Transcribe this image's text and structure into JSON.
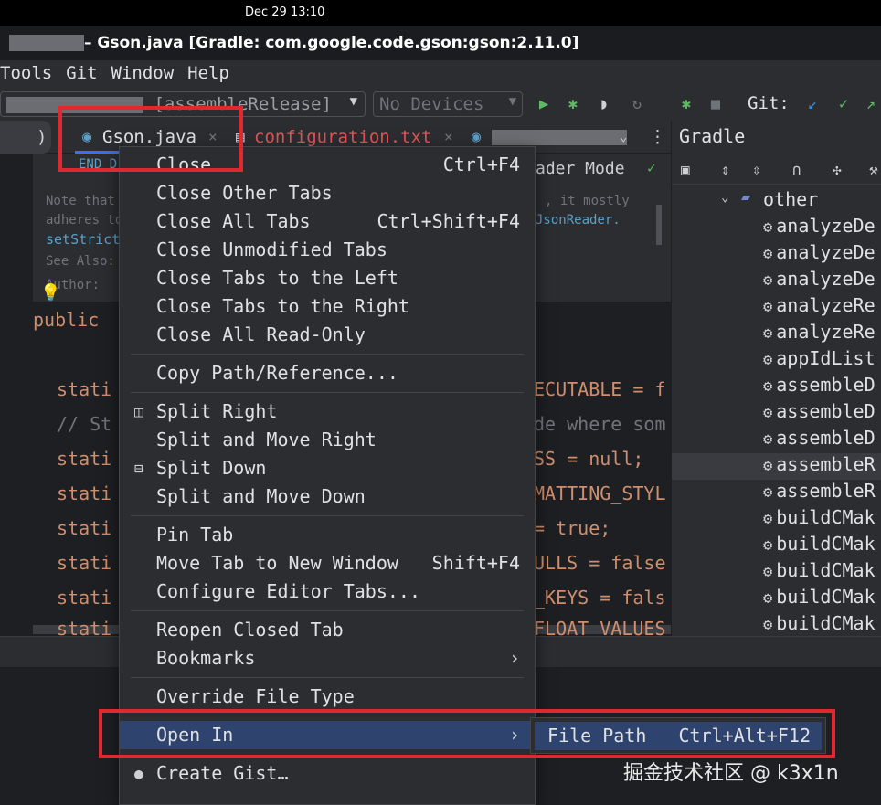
{
  "system": {
    "clock": "Dec 29  13:10"
  },
  "window": {
    "title": "– Gson.java [Gradle: com.google.code.gson:gson:2.11.0]"
  },
  "menubar": {
    "items": [
      "Tools",
      "Git",
      "Window",
      "Help"
    ]
  },
  "toolbar": {
    "config": "[assembleRelease]",
    "devices": "No Devices",
    "git_label": "Git:"
  },
  "tabs": {
    "active": "Gson.java",
    "second": "configuration.txt",
    "left_fragment": ")"
  },
  "editor": {
    "doc_lines": [
      "END D",
      "Note that",
      "adheres to",
      "setStrict",
      "See Also:",
      "Author:"
    ],
    "doc_right": [
      "ader Mode",
      ", it mostly",
      "JsonReader."
    ],
    "code_left": [
      "public",
      "stati",
      "// St",
      "stati",
      "stati",
      "stati",
      "stati",
      "stati",
      "stati"
    ],
    "code_right": [
      "ECUTABLE = f",
      "de where som",
      "SS = null;",
      "MATTING_STYL",
      " = true;",
      "ULLS = false",
      "_KEYS = fals",
      "FLOAT_VALUES"
    ]
  },
  "gradle": {
    "title": "Gradle",
    "group": "other",
    "tasks": [
      "analyzeDe",
      "analyzeDe",
      "analyzeDe",
      "analyzeRe",
      "analyzeRe",
      "appIdList",
      "assembleD",
      "assembleD",
      "assembleD",
      "assembleR",
      "assembleR",
      "buildCMak",
      "buildCMak",
      "buildCMak",
      "buildCMak",
      "buildCMak"
    ]
  },
  "context_menu": {
    "items": [
      {
        "label": "Close",
        "shortcut": "Ctrl+F4"
      },
      {
        "label": "Close Other Tabs",
        "shortcut": ""
      },
      {
        "label": "Close All Tabs",
        "shortcut": "Ctrl+Shift+F4"
      },
      {
        "label": "Close Unmodified Tabs",
        "shortcut": ""
      },
      {
        "label": "Close Tabs to the Left",
        "shortcut": ""
      },
      {
        "label": "Close Tabs to the Right",
        "shortcut": ""
      },
      {
        "label": "Close All Read-Only",
        "shortcut": ""
      },
      {
        "label": "Copy Path/Reference...",
        "shortcut": ""
      },
      {
        "label": "Split Right",
        "shortcut": ""
      },
      {
        "label": "Split and Move Right",
        "shortcut": ""
      },
      {
        "label": "Split Down",
        "shortcut": ""
      },
      {
        "label": "Split and Move Down",
        "shortcut": ""
      },
      {
        "label": "Pin Tab",
        "shortcut": ""
      },
      {
        "label": "Move Tab to New Window",
        "shortcut": "Shift+F4"
      },
      {
        "label": "Configure Editor Tabs...",
        "shortcut": ""
      },
      {
        "label": "Reopen Closed Tab",
        "shortcut": ""
      },
      {
        "label": "Bookmarks",
        "shortcut": ""
      },
      {
        "label": "Override File Type",
        "shortcut": ""
      },
      {
        "label": "Open In",
        "shortcut": ""
      },
      {
        "label": "Create Gist…",
        "shortcut": ""
      }
    ]
  },
  "submenu": {
    "label": "File Path",
    "shortcut": "Ctrl+Alt+F12"
  },
  "watermark": "掘金技术社区 @ k3x1n",
  "colors": {
    "accent_blue": "#2e436e",
    "highlight_red": "#e0282e",
    "keyword_orange": "#cf8e6d",
    "run_green": "#5fb865"
  }
}
